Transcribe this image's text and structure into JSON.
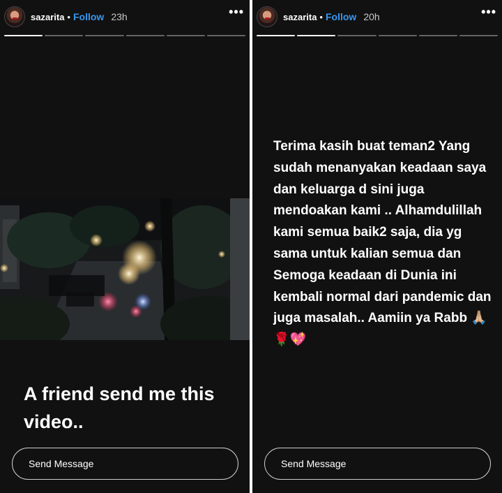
{
  "stories": [
    {
      "username": "sazarita",
      "follow_label": "Follow",
      "time_ago": "23h",
      "more_label": "•••",
      "caption": "A friend send me this video..",
      "send_placeholder": "Send Message",
      "progress": {
        "segments": 6,
        "completed": 1
      }
    },
    {
      "username": "sazarita",
      "follow_label": "Follow",
      "time_ago": "20h",
      "more_label": "•••",
      "text": "Terima kasih buat teman2 Yang sudah menanyakan keadaan saya dan keluarga d sini juga mendoakan kami .. Alhamdulillah kami semua baik2 saja, dia yg sama untuk kalian semua dan Semoga keadaan di Dunia ini kembali normal dari pandemic dan juga masalah.. Aamiin ya Rabb 🙏🏼🌹💖",
      "send_placeholder": "Send Message",
      "progress": {
        "segments": 6,
        "completed": 2
      }
    }
  ],
  "colors": {
    "background": "#111111",
    "follow": "#3897f0",
    "text": "#ffffff"
  }
}
